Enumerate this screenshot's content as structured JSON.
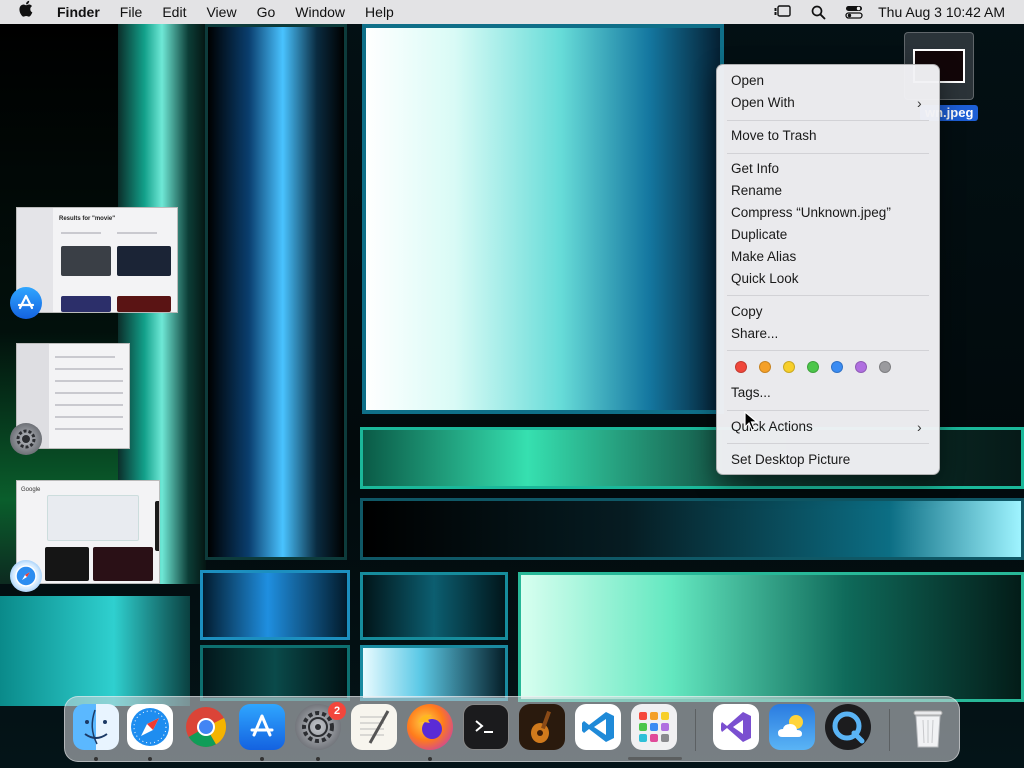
{
  "menubar": {
    "app_name": "Finder",
    "menus": [
      "File",
      "Edit",
      "View",
      "Go",
      "Window",
      "Help"
    ],
    "clock": "Thu Aug 3  10:42 AM",
    "icons": [
      "apple-icon",
      "stage-manager-icon",
      "spotlight-search-icon",
      "control-center-icon"
    ]
  },
  "desktop": {
    "file_label": "Unknown.jpeg",
    "file_label_visible": "wn.jpeg"
  },
  "stage_manager": {
    "groups": [
      {
        "app_icon": "app-store-icon",
        "window_title": "Results for \"movie\""
      },
      {
        "app_icon": "system-settings-icon"
      },
      {
        "app_icon": "safari-icon",
        "window_title": "Google"
      }
    ]
  },
  "context_menu": {
    "items": [
      {
        "label": "Open"
      },
      {
        "label": "Open With",
        "submenu": true
      },
      {
        "label": "Move to Trash"
      },
      {
        "label": "Get Info"
      },
      {
        "label": "Rename"
      },
      {
        "label": "Compress “Unknown.jpeg”"
      },
      {
        "label": "Duplicate"
      },
      {
        "label": "Make Alias"
      },
      {
        "label": "Quick Look"
      },
      {
        "label": "Copy"
      },
      {
        "label": "Share..."
      },
      {
        "label": "Tags..."
      },
      {
        "label": "Quick Actions",
        "submenu": true
      },
      {
        "label": "Set Desktop Picture"
      }
    ],
    "tag_colors": [
      "#f0473b",
      "#f4a028",
      "#f7cf2a",
      "#4cc64a",
      "#3b8cf3",
      "#b06fe0",
      "#9a9a9e"
    ],
    "tag_names": [
      "red-tag",
      "orange-tag",
      "yellow-tag",
      "green-tag",
      "blue-tag",
      "purple-tag",
      "gray-tag"
    ]
  },
  "dock": {
    "apps": [
      {
        "name": "Finder",
        "icon": "finder-icon",
        "running": true
      },
      {
        "name": "Safari",
        "icon": "safari-icon",
        "running": true
      },
      {
        "name": "Google Chrome",
        "icon": "chrome-icon",
        "running": false
      },
      {
        "name": "App Store",
        "icon": "app-store-icon",
        "running": true
      },
      {
        "name": "System Settings",
        "icon": "system-settings-icon",
        "running": true,
        "badge": "2"
      },
      {
        "name": "TextEdit",
        "icon": "textedit-icon",
        "running": false
      },
      {
        "name": "Firefox",
        "icon": "firefox-icon",
        "running": true
      },
      {
        "name": "Terminal",
        "icon": "terminal-icon",
        "running": false
      },
      {
        "name": "GarageBand",
        "icon": "garageband-icon",
        "running": false
      },
      {
        "name": "Visual Studio Code",
        "icon": "vscode-icon",
        "running": false
      },
      {
        "name": "Launchpad",
        "icon": "launchpad-icon",
        "running": false
      },
      {
        "name": "Visual Studio",
        "icon": "visual-studio-icon",
        "running": false
      },
      {
        "name": "Weather",
        "icon": "weather-icon",
        "running": false
      },
      {
        "name": "QuickTime Player",
        "icon": "quicktime-icon",
        "running": false
      },
      {
        "name": "Trash",
        "icon": "trash-icon",
        "running": false
      }
    ],
    "badge": "2"
  }
}
